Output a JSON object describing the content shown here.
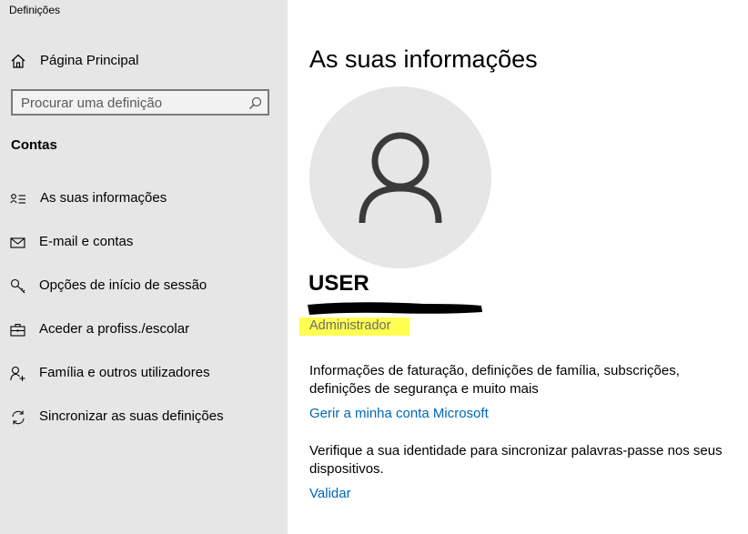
{
  "window": {
    "title": "Definições"
  },
  "sidebar": {
    "home_label": "Página Principal",
    "search": {
      "placeholder": "Procurar uma definição",
      "value": ""
    },
    "section_title": "Contas",
    "items": [
      {
        "label": "As suas informações",
        "icon": "user-info-icon",
        "selected": true
      },
      {
        "label": "E-mail e contas",
        "icon": "mail-icon"
      },
      {
        "label": "Opções de início de sessão",
        "icon": "key-icon"
      },
      {
        "label": "Aceder a profiss./escolar",
        "icon": "briefcase-icon"
      },
      {
        "label": "Família e outros utilizadores",
        "icon": "person-add-icon"
      },
      {
        "label": "Sincronizar as suas definições",
        "icon": "sync-icon"
      }
    ]
  },
  "main": {
    "title": "As suas informações",
    "user_name": "USER",
    "role": "Administrador",
    "info_text": "Informações de faturação, definições de família, subscrições, definições de segurança e muito mais",
    "manage_link": "Gerir a minha conta Microsoft",
    "verify_text": "Verifique a sua identidade para sincronizar palavras-passe nos seus dispositivos.",
    "verify_link": "Validar"
  },
  "colors": {
    "sidebar_bg": "#e6e6e6",
    "link": "#0067b8",
    "highlight": "#ffff52",
    "redaction": "#000000"
  }
}
